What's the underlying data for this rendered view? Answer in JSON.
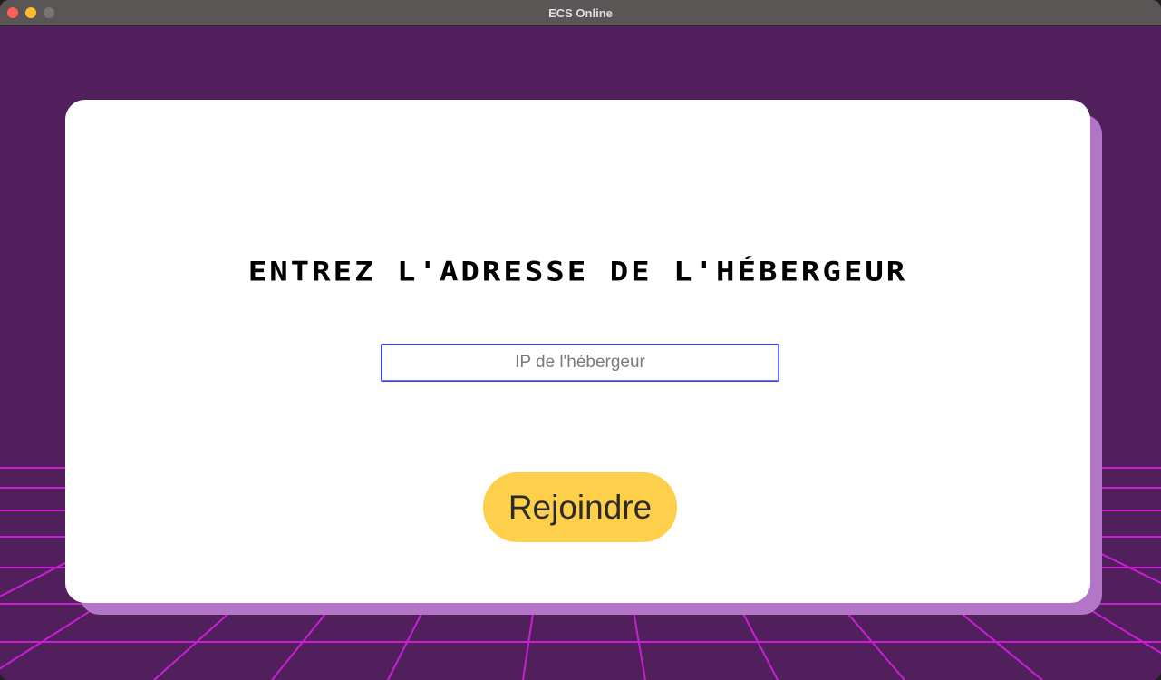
{
  "window": {
    "title": "ECS Online",
    "controls": [
      "close",
      "minimize",
      "zoom"
    ]
  },
  "colors": {
    "background": "#51205c",
    "grid_lines": "#c81fd6",
    "card": "#ffffff",
    "card_shadow": "#b375c6",
    "button": "#fdcf4b",
    "input_border": "#3a43e8"
  },
  "join_form": {
    "heading": "ENTREZ L'ADRESSE DE L'HÉBERGEUR",
    "ip_input": {
      "value": "",
      "placeholder": "IP de l'hébergeur"
    },
    "join_button_label": "Rejoindre"
  }
}
